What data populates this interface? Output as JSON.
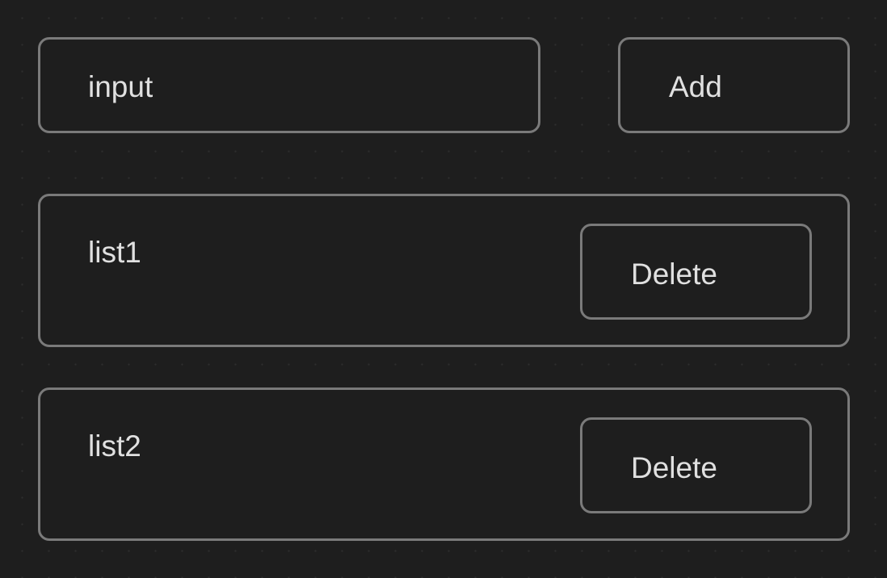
{
  "form": {
    "input_value": "input",
    "add_label": "Add"
  },
  "list": {
    "items": [
      {
        "label": "list1",
        "delete_label": "Delete"
      },
      {
        "label": "list2",
        "delete_label": "Delete"
      }
    ]
  }
}
